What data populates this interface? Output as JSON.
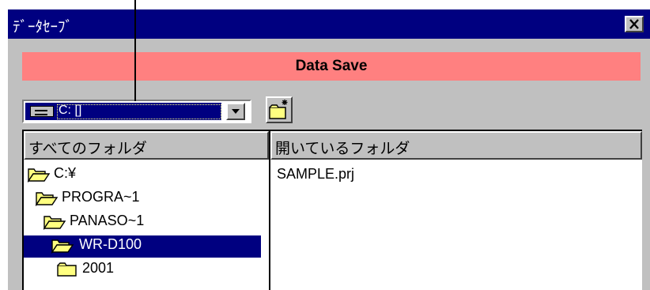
{
  "window": {
    "title": "ﾃﾞｰﾀｾｰﾌﾞ",
    "close_label": "✕"
  },
  "header": {
    "title": "Data Save",
    "color": "#ff8080"
  },
  "drive": {
    "selected": "C: []"
  },
  "tree": {
    "header": "すべてのフォルダ",
    "items": [
      {
        "label": "C:¥",
        "selected": false
      },
      {
        "label": "PROGRA~1",
        "selected": false
      },
      {
        "label": "PANASO~1",
        "selected": false
      },
      {
        "label": "WR-D100",
        "selected": true
      },
      {
        "label": "2001",
        "selected": false
      }
    ]
  },
  "files": {
    "header": "開いているフォルダ",
    "items": [
      "SAMPLE.prj"
    ]
  },
  "colors": {
    "titlebar": "#000080",
    "face": "#c0c0c0",
    "selection": "#000080",
    "folder": "#ffff80"
  }
}
